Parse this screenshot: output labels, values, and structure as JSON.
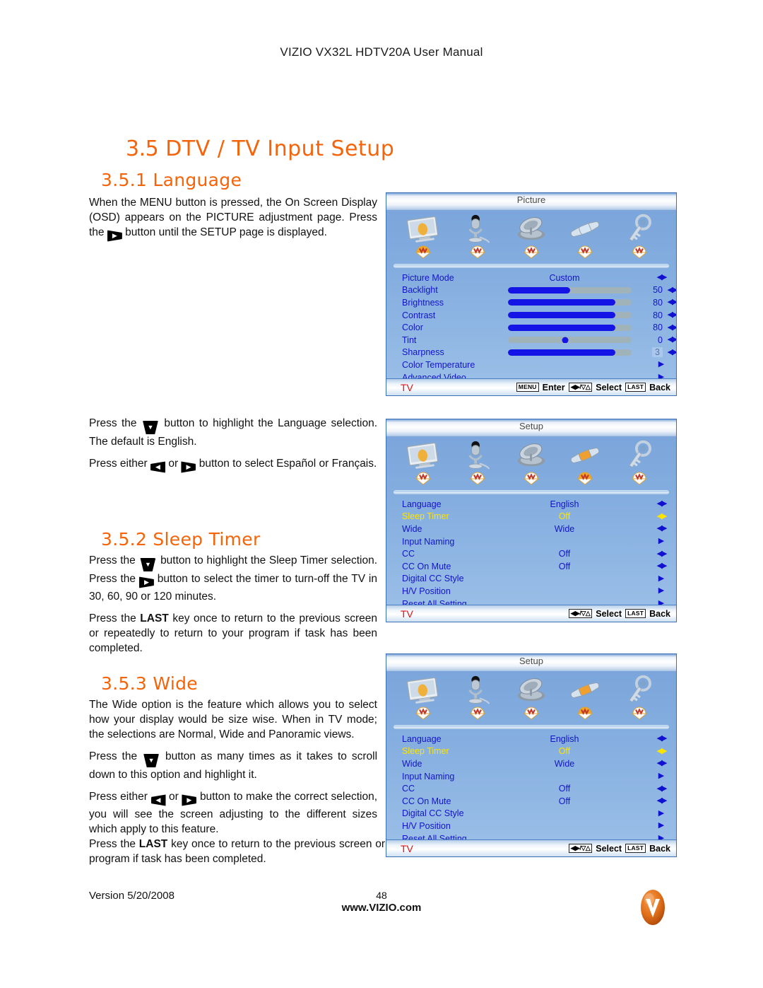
{
  "header": {
    "title": "VIZIO VX32L HDTV20A User Manual"
  },
  "headings": {
    "main_number": "3.5",
    "main_title": "DTV / TV Input Setup",
    "sec1_number": "3.5.1",
    "sec1_title": "Language",
    "sec2_number": "3.5.2",
    "sec2_title": "Sleep Timer",
    "sec3_number": "3.5.3",
    "sec3_title": "Wide"
  },
  "body": {
    "language_p1_a": "When the MENU button is pressed, the On Screen Display (OSD) appears on the PICTURE adjustment page.  Press the ",
    "language_p1_b": " button until the SETUP page is displayed.",
    "language_p2_a": "Press the ",
    "language_p2_b": " button to highlight the Language selection.  The default is English.",
    "language_p3_a": "Press either ",
    "language_p3_b": " or ",
    "language_p3_c": " button to select Español or Français.",
    "sleep_p1_a": "Press the ",
    "sleep_p1_b": " button to highlight the Sleep Timer selection.  Press the ",
    "sleep_p1_c": " button to select the timer to turn-off the TV in 30, 60, 90 or 120 minutes.",
    "sleep_p2_a": "Press the ",
    "sleep_p2_key": "LAST",
    "sleep_p2_b": " key once to return to the previous screen or repeatedly to return to your program if task has been completed.",
    "wide_p1": "The Wide option is the feature which allows you to select how your display would be size wise. When in TV mode; the selections are Normal, Wide and Panoramic views.",
    "wide_p2_a": "Press the ",
    "wide_p2_b": " button as many times as it takes to scroll down to this option and highlight it.",
    "wide_p3_a": "Press either ",
    "wide_p3_b": " or ",
    "wide_p3_c": " button to make the correct selection, you will see the screen adjusting to the different sizes which apply to this feature.",
    "wide_p4_a": "Press the ",
    "wide_p4_key": "LAST",
    "wide_p4_b": " key once to return to the previous screen or repeatedly to return to your program if task has been completed."
  },
  "osd_picture": {
    "title": "Picture",
    "tabs": [
      "picture-icon",
      "audio-microphone-icon",
      "satellite-dish-icon",
      "setup-wrench-icon",
      "parental-key-icon"
    ],
    "active_tab_index": 0,
    "rows": [
      {
        "label": "Picture Mode",
        "value": "Custom",
        "control": "lr"
      },
      {
        "label": "Backlight",
        "value": "50",
        "control": "slider",
        "fill": 50
      },
      {
        "label": "Brightness",
        "value": "80",
        "control": "slider",
        "fill": 87
      },
      {
        "label": "Contrast",
        "value": "80",
        "control": "slider",
        "fill": 87
      },
      {
        "label": "Color",
        "value": "80",
        "control": "slider",
        "fill": 87
      },
      {
        "label": "Tint",
        "value": "0",
        "control": "knob",
        "fill": 46
      },
      {
        "label": "Sharpness",
        "value": "3",
        "control": "slider",
        "fill": 87,
        "highlight": true
      },
      {
        "label": "Color Temperature",
        "value": "",
        "control": "right"
      },
      {
        "label": "Advanced Video",
        "value": "",
        "control": "right"
      }
    ],
    "footer_source": "TV",
    "footer_hints": [
      {
        "key": "MENU",
        "text": "Enter"
      },
      {
        "key": "nav",
        "text": "Select"
      },
      {
        "key": "LAST",
        "text": "Back"
      }
    ]
  },
  "osd_setup": {
    "title": "Setup",
    "tabs": [
      "picture-icon",
      "audio-microphone-icon",
      "satellite-dish-icon",
      "setup-wrench-icon",
      "parental-key-icon"
    ],
    "active_tab_index": 3,
    "rows": [
      {
        "label": "Language",
        "value": "English",
        "control": "lr"
      },
      {
        "label": "Sleep Timer",
        "value": "Off",
        "control": "lr",
        "selected": true
      },
      {
        "label": "Wide",
        "value": "Wide",
        "control": "lr"
      },
      {
        "label": "Input Naming",
        "value": "",
        "control": "right"
      },
      {
        "label": "CC",
        "value": "Off",
        "control": "lr"
      },
      {
        "label": "CC On Mute",
        "value": "Off",
        "control": "lr"
      },
      {
        "label": "Digital CC Style",
        "value": "",
        "control": "right"
      },
      {
        "label": "H/V Position",
        "value": "",
        "control": "right"
      },
      {
        "label": "Reset All Setting",
        "value": "",
        "control": "right"
      }
    ],
    "footer_source": "TV",
    "footer_hints": [
      {
        "key": "nav",
        "text": "Select"
      },
      {
        "key": "LAST",
        "text": "Back"
      }
    ]
  },
  "footer": {
    "version": "Version 5/20/2008",
    "page_number": "48",
    "url": "www.VIZIO.com",
    "logo": "vizio-v-logo"
  },
  "colors": {
    "accent_orange": "#f4640a",
    "osd_blue": "#7fa9dd",
    "osd_label_blue": "#1414c8",
    "osd_selected_yellow": "#ffe400",
    "osd_source_red": "#e01010",
    "slider_fill": "#1414e6",
    "slider_track": "#9fb3b8"
  }
}
